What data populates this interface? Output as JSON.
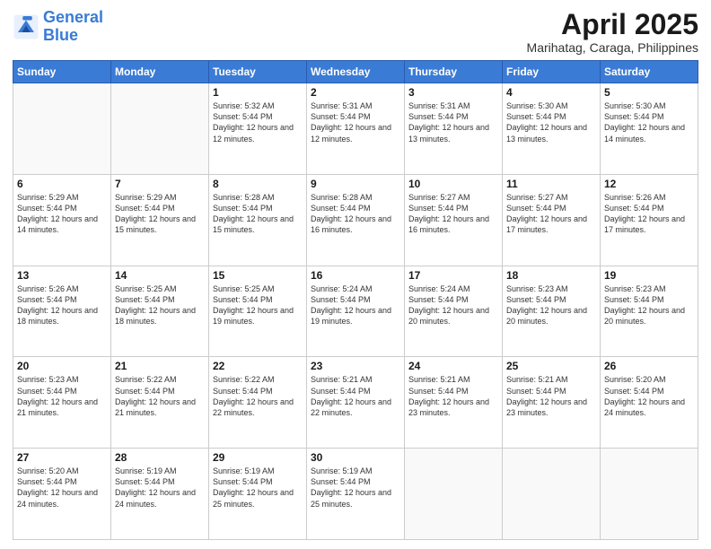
{
  "logo": {
    "line1": "General",
    "line2": "Blue"
  },
  "title": "April 2025",
  "subtitle": "Marihatag, Caraga, Philippines",
  "weekdays": [
    "Sunday",
    "Monday",
    "Tuesday",
    "Wednesday",
    "Thursday",
    "Friday",
    "Saturday"
  ],
  "weeks": [
    [
      {
        "day": "",
        "empty": true
      },
      {
        "day": "",
        "empty": true
      },
      {
        "day": "1",
        "sunrise": "5:32 AM",
        "sunset": "5:44 PM",
        "daylight": "12 hours and 12 minutes."
      },
      {
        "day": "2",
        "sunrise": "5:31 AM",
        "sunset": "5:44 PM",
        "daylight": "12 hours and 12 minutes."
      },
      {
        "day": "3",
        "sunrise": "5:31 AM",
        "sunset": "5:44 PM",
        "daylight": "12 hours and 13 minutes."
      },
      {
        "day": "4",
        "sunrise": "5:30 AM",
        "sunset": "5:44 PM",
        "daylight": "12 hours and 13 minutes."
      },
      {
        "day": "5",
        "sunrise": "5:30 AM",
        "sunset": "5:44 PM",
        "daylight": "12 hours and 14 minutes."
      }
    ],
    [
      {
        "day": "6",
        "sunrise": "5:29 AM",
        "sunset": "5:44 PM",
        "daylight": "12 hours and 14 minutes."
      },
      {
        "day": "7",
        "sunrise": "5:29 AM",
        "sunset": "5:44 PM",
        "daylight": "12 hours and 15 minutes."
      },
      {
        "day": "8",
        "sunrise": "5:28 AM",
        "sunset": "5:44 PM",
        "daylight": "12 hours and 15 minutes."
      },
      {
        "day": "9",
        "sunrise": "5:28 AM",
        "sunset": "5:44 PM",
        "daylight": "12 hours and 16 minutes."
      },
      {
        "day": "10",
        "sunrise": "5:27 AM",
        "sunset": "5:44 PM",
        "daylight": "12 hours and 16 minutes."
      },
      {
        "day": "11",
        "sunrise": "5:27 AM",
        "sunset": "5:44 PM",
        "daylight": "12 hours and 17 minutes."
      },
      {
        "day": "12",
        "sunrise": "5:26 AM",
        "sunset": "5:44 PM",
        "daylight": "12 hours and 17 minutes."
      }
    ],
    [
      {
        "day": "13",
        "sunrise": "5:26 AM",
        "sunset": "5:44 PM",
        "daylight": "12 hours and 18 minutes."
      },
      {
        "day": "14",
        "sunrise": "5:25 AM",
        "sunset": "5:44 PM",
        "daylight": "12 hours and 18 minutes."
      },
      {
        "day": "15",
        "sunrise": "5:25 AM",
        "sunset": "5:44 PM",
        "daylight": "12 hours and 19 minutes."
      },
      {
        "day": "16",
        "sunrise": "5:24 AM",
        "sunset": "5:44 PM",
        "daylight": "12 hours and 19 minutes."
      },
      {
        "day": "17",
        "sunrise": "5:24 AM",
        "sunset": "5:44 PM",
        "daylight": "12 hours and 20 minutes."
      },
      {
        "day": "18",
        "sunrise": "5:23 AM",
        "sunset": "5:44 PM",
        "daylight": "12 hours and 20 minutes."
      },
      {
        "day": "19",
        "sunrise": "5:23 AM",
        "sunset": "5:44 PM",
        "daylight": "12 hours and 20 minutes."
      }
    ],
    [
      {
        "day": "20",
        "sunrise": "5:23 AM",
        "sunset": "5:44 PM",
        "daylight": "12 hours and 21 minutes."
      },
      {
        "day": "21",
        "sunrise": "5:22 AM",
        "sunset": "5:44 PM",
        "daylight": "12 hours and 21 minutes."
      },
      {
        "day": "22",
        "sunrise": "5:22 AM",
        "sunset": "5:44 PM",
        "daylight": "12 hours and 22 minutes."
      },
      {
        "day": "23",
        "sunrise": "5:21 AM",
        "sunset": "5:44 PM",
        "daylight": "12 hours and 22 minutes."
      },
      {
        "day": "24",
        "sunrise": "5:21 AM",
        "sunset": "5:44 PM",
        "daylight": "12 hours and 23 minutes."
      },
      {
        "day": "25",
        "sunrise": "5:21 AM",
        "sunset": "5:44 PM",
        "daylight": "12 hours and 23 minutes."
      },
      {
        "day": "26",
        "sunrise": "5:20 AM",
        "sunset": "5:44 PM",
        "daylight": "12 hours and 24 minutes."
      }
    ],
    [
      {
        "day": "27",
        "sunrise": "5:20 AM",
        "sunset": "5:44 PM",
        "daylight": "12 hours and 24 minutes."
      },
      {
        "day": "28",
        "sunrise": "5:19 AM",
        "sunset": "5:44 PM",
        "daylight": "12 hours and 24 minutes."
      },
      {
        "day": "29",
        "sunrise": "5:19 AM",
        "sunset": "5:44 PM",
        "daylight": "12 hours and 25 minutes."
      },
      {
        "day": "30",
        "sunrise": "5:19 AM",
        "sunset": "5:44 PM",
        "daylight": "12 hours and 25 minutes."
      },
      {
        "day": "",
        "empty": true
      },
      {
        "day": "",
        "empty": true
      },
      {
        "day": "",
        "empty": true
      }
    ]
  ]
}
